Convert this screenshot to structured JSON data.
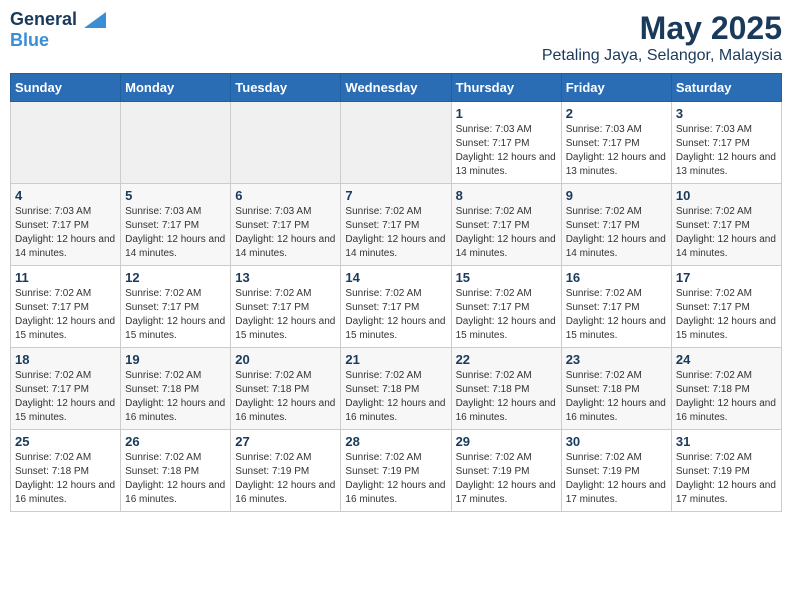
{
  "header": {
    "logo_line1": "General",
    "logo_line2": "Blue",
    "title": "May 2025",
    "subtitle": "Petaling Jaya, Selangor, Malaysia"
  },
  "weekdays": [
    "Sunday",
    "Monday",
    "Tuesday",
    "Wednesday",
    "Thursday",
    "Friday",
    "Saturday"
  ],
  "weeks": [
    [
      {
        "day": "",
        "empty": true
      },
      {
        "day": "",
        "empty": true
      },
      {
        "day": "",
        "empty": true
      },
      {
        "day": "",
        "empty": true
      },
      {
        "day": "1",
        "sunrise": "7:03 AM",
        "sunset": "7:17 PM",
        "daylight": "12 hours and 13 minutes."
      },
      {
        "day": "2",
        "sunrise": "7:03 AM",
        "sunset": "7:17 PM",
        "daylight": "12 hours and 13 minutes."
      },
      {
        "day": "3",
        "sunrise": "7:03 AM",
        "sunset": "7:17 PM",
        "daylight": "12 hours and 13 minutes."
      }
    ],
    [
      {
        "day": "4",
        "sunrise": "7:03 AM",
        "sunset": "7:17 PM",
        "daylight": "12 hours and 14 minutes."
      },
      {
        "day": "5",
        "sunrise": "7:03 AM",
        "sunset": "7:17 PM",
        "daylight": "12 hours and 14 minutes."
      },
      {
        "day": "6",
        "sunrise": "7:03 AM",
        "sunset": "7:17 PM",
        "daylight": "12 hours and 14 minutes."
      },
      {
        "day": "7",
        "sunrise": "7:02 AM",
        "sunset": "7:17 PM",
        "daylight": "12 hours and 14 minutes."
      },
      {
        "day": "8",
        "sunrise": "7:02 AM",
        "sunset": "7:17 PM",
        "daylight": "12 hours and 14 minutes."
      },
      {
        "day": "9",
        "sunrise": "7:02 AM",
        "sunset": "7:17 PM",
        "daylight": "12 hours and 14 minutes."
      },
      {
        "day": "10",
        "sunrise": "7:02 AM",
        "sunset": "7:17 PM",
        "daylight": "12 hours and 14 minutes."
      }
    ],
    [
      {
        "day": "11",
        "sunrise": "7:02 AM",
        "sunset": "7:17 PM",
        "daylight": "12 hours and 15 minutes."
      },
      {
        "day": "12",
        "sunrise": "7:02 AM",
        "sunset": "7:17 PM",
        "daylight": "12 hours and 15 minutes."
      },
      {
        "day": "13",
        "sunrise": "7:02 AM",
        "sunset": "7:17 PM",
        "daylight": "12 hours and 15 minutes."
      },
      {
        "day": "14",
        "sunrise": "7:02 AM",
        "sunset": "7:17 PM",
        "daylight": "12 hours and 15 minutes."
      },
      {
        "day": "15",
        "sunrise": "7:02 AM",
        "sunset": "7:17 PM",
        "daylight": "12 hours and 15 minutes."
      },
      {
        "day": "16",
        "sunrise": "7:02 AM",
        "sunset": "7:17 PM",
        "daylight": "12 hours and 15 minutes."
      },
      {
        "day": "17",
        "sunrise": "7:02 AM",
        "sunset": "7:17 PM",
        "daylight": "12 hours and 15 minutes."
      }
    ],
    [
      {
        "day": "18",
        "sunrise": "7:02 AM",
        "sunset": "7:17 PM",
        "daylight": "12 hours and 15 minutes."
      },
      {
        "day": "19",
        "sunrise": "7:02 AM",
        "sunset": "7:18 PM",
        "daylight": "12 hours and 16 minutes."
      },
      {
        "day": "20",
        "sunrise": "7:02 AM",
        "sunset": "7:18 PM",
        "daylight": "12 hours and 16 minutes."
      },
      {
        "day": "21",
        "sunrise": "7:02 AM",
        "sunset": "7:18 PM",
        "daylight": "12 hours and 16 minutes."
      },
      {
        "day": "22",
        "sunrise": "7:02 AM",
        "sunset": "7:18 PM",
        "daylight": "12 hours and 16 minutes."
      },
      {
        "day": "23",
        "sunrise": "7:02 AM",
        "sunset": "7:18 PM",
        "daylight": "12 hours and 16 minutes."
      },
      {
        "day": "24",
        "sunrise": "7:02 AM",
        "sunset": "7:18 PM",
        "daylight": "12 hours and 16 minutes."
      }
    ],
    [
      {
        "day": "25",
        "sunrise": "7:02 AM",
        "sunset": "7:18 PM",
        "daylight": "12 hours and 16 minutes."
      },
      {
        "day": "26",
        "sunrise": "7:02 AM",
        "sunset": "7:18 PM",
        "daylight": "12 hours and 16 minutes."
      },
      {
        "day": "27",
        "sunrise": "7:02 AM",
        "sunset": "7:19 PM",
        "daylight": "12 hours and 16 minutes."
      },
      {
        "day": "28",
        "sunrise": "7:02 AM",
        "sunset": "7:19 PM",
        "daylight": "12 hours and 16 minutes."
      },
      {
        "day": "29",
        "sunrise": "7:02 AM",
        "sunset": "7:19 PM",
        "daylight": "12 hours and 17 minutes."
      },
      {
        "day": "30",
        "sunrise": "7:02 AM",
        "sunset": "7:19 PM",
        "daylight": "12 hours and 17 minutes."
      },
      {
        "day": "31",
        "sunrise": "7:02 AM",
        "sunset": "7:19 PM",
        "daylight": "12 hours and 17 minutes."
      }
    ]
  ]
}
